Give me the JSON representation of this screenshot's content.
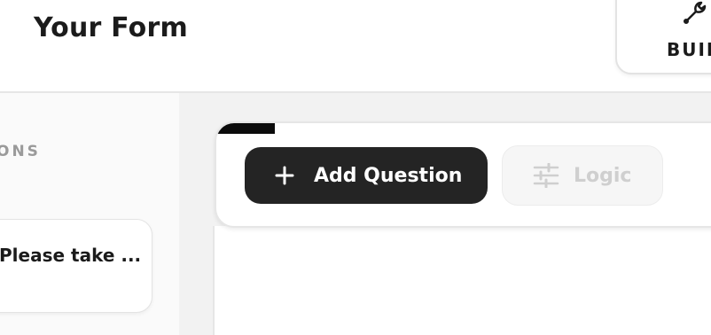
{
  "header": {
    "title": "Your Form",
    "build_tab_label": "BUIL"
  },
  "sidebar": {
    "heading": "ONS",
    "question_card_text": "Please take ..."
  },
  "toolbar": {
    "add_question_label": "Add Question",
    "logic_label": "Logic"
  },
  "icons": {
    "build_tab": "wrench-icon",
    "add_question": "plus-icon",
    "logic": "sliders-icon"
  },
  "colors": {
    "primary_button": "#242424",
    "disabled_text": "#cfcfcf",
    "accent": "#0b0b0b"
  }
}
